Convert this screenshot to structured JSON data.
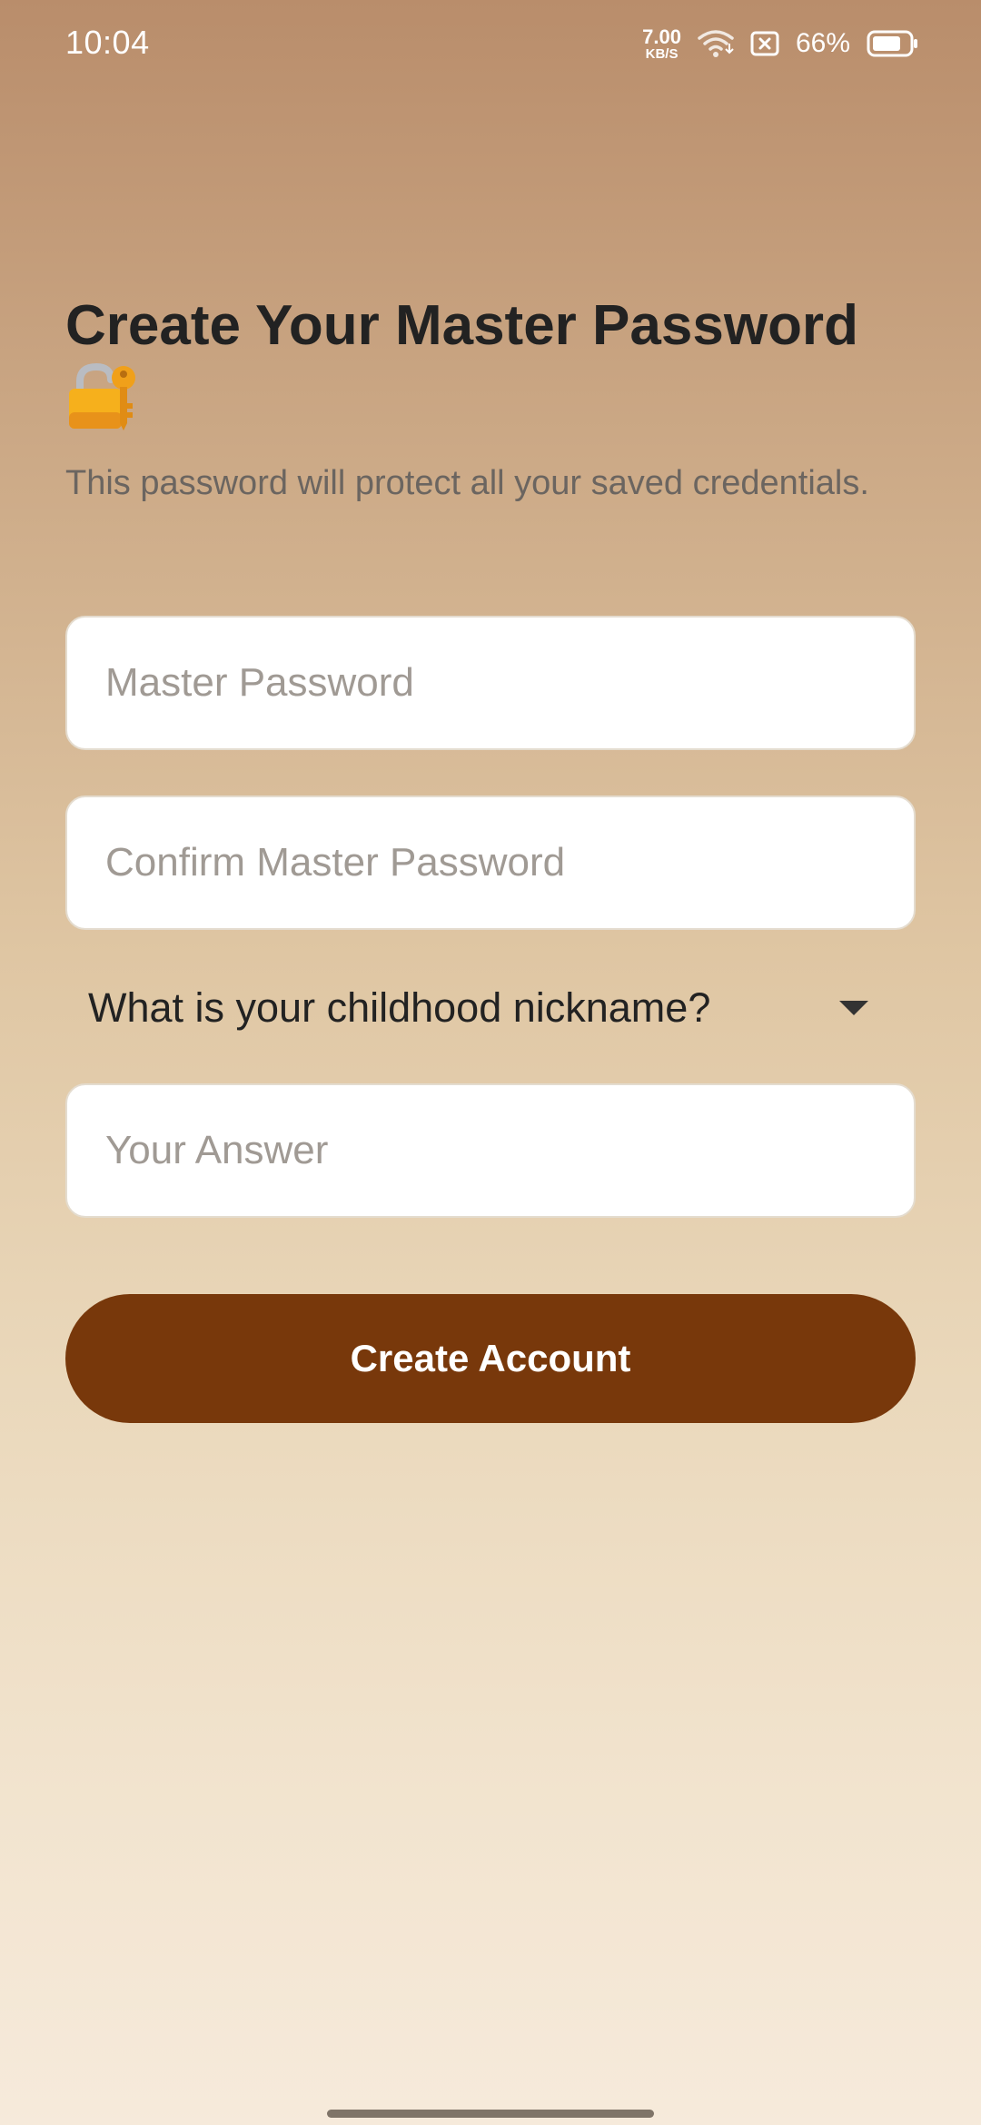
{
  "status_bar": {
    "time": "10:04",
    "net_speed_value": "7.00",
    "net_speed_unit": "KB/S",
    "battery_percent": "66%",
    "icons": [
      "wifi-icon",
      "sim-blocked-icon",
      "battery-icon"
    ]
  },
  "header": {
    "title": "Create Your Master Password",
    "title_icon": "lock-with-key-emoji",
    "subtitle": "This password will protect all your saved credentials."
  },
  "form": {
    "master_password": {
      "placeholder": "Master Password",
      "value": ""
    },
    "confirm_password": {
      "placeholder": "Confirm Master Password",
      "value": ""
    },
    "security_question": {
      "selected": "What is your childhood nickname?"
    },
    "answer": {
      "placeholder": "Your Answer",
      "value": ""
    },
    "submit_label": "Create Account"
  },
  "colors": {
    "accent": "#78380b",
    "gradient_top": "#b98d6b",
    "gradient_bottom": "#f6eadb"
  }
}
